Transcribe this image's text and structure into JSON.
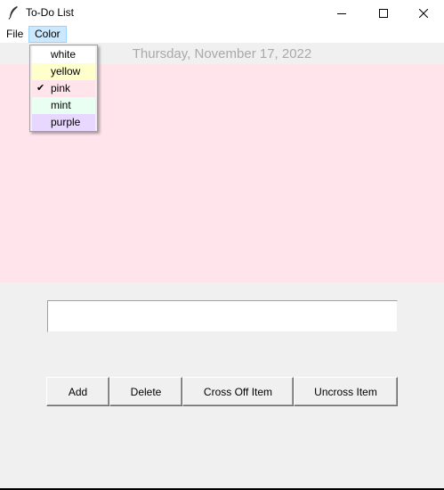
{
  "window": {
    "title": "To-Do List",
    "icon": "feather-icon",
    "controls": [
      "minimize-icon",
      "maximize-icon",
      "close-icon"
    ]
  },
  "menubar": {
    "file_label": "File",
    "color_label": "Color"
  },
  "color_menu": {
    "items": [
      {
        "label": "white",
        "color": "#ffffff",
        "checked": false
      },
      {
        "label": "yellow",
        "color": "#ffffcc",
        "checked": false
      },
      {
        "label": "pink",
        "color": "#ffe4ec",
        "checked": true
      },
      {
        "label": "mint",
        "color": "#e8fff2",
        "checked": false
      },
      {
        "label": "purple",
        "color": "#e8d8ff",
        "checked": false
      }
    ],
    "check_mark": "✔"
  },
  "date_label": "Thursday, November 17, 2022",
  "list_background": "#ffe4ec",
  "entry": {
    "value": ""
  },
  "buttons": {
    "add": "Add",
    "delete": "Delete",
    "cross_off": "Cross Off Item",
    "uncross": "Uncross Item"
  }
}
